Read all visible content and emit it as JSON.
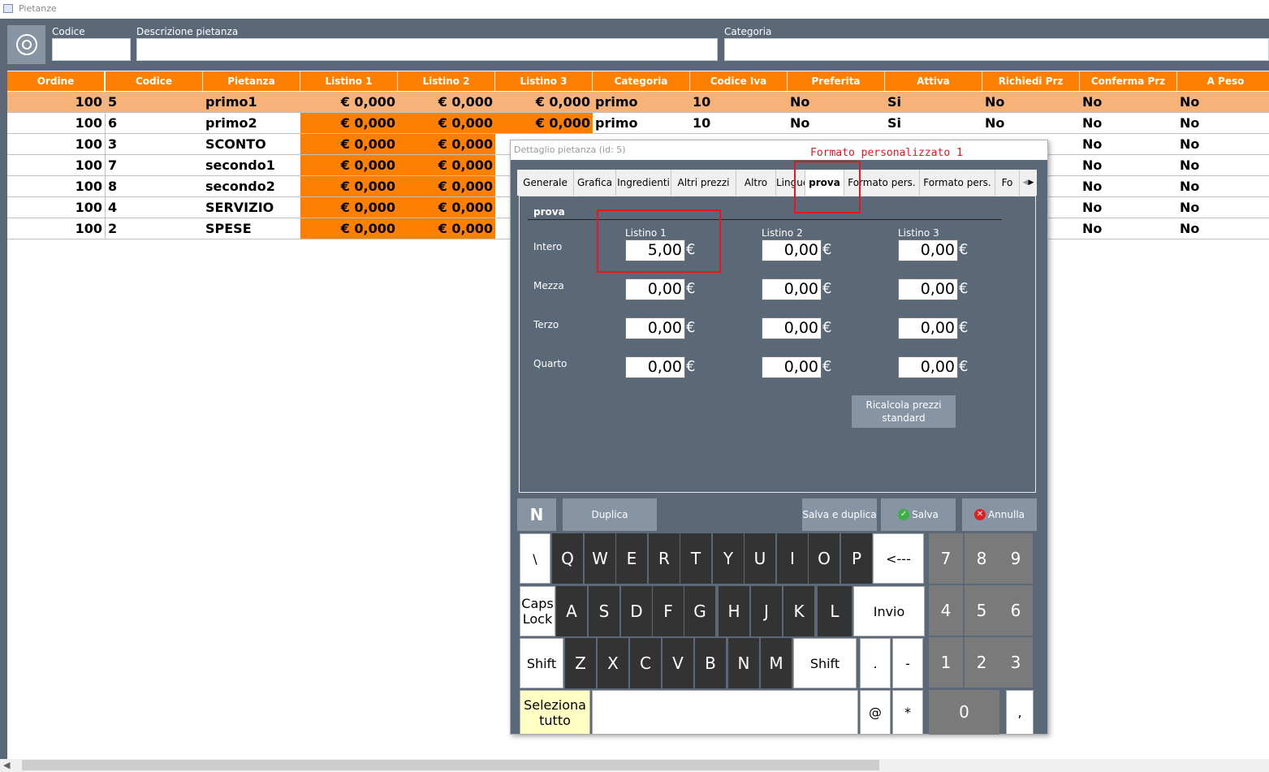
{
  "window": {
    "title": "Pietanze"
  },
  "filters": {
    "codice_label": "Codice",
    "descrizione_label": "Descrizione pietanza",
    "categoria_label": "Categoria",
    "codice_value": "",
    "descrizione_value": "",
    "categoria_value": ""
  },
  "table": {
    "columns": [
      "Ordine",
      "Codice",
      "Pietanza",
      "Listino 1",
      "Listino 2",
      "Listino 3",
      "Categoria",
      "Codice Iva",
      "Preferita",
      "Attiva",
      "Richiedi Prz",
      "Conferma Prz",
      "A Peso"
    ],
    "rows": [
      [
        "100",
        "5",
        "primo1",
        "€ 0,000",
        "€ 0,000",
        "€ 0,000",
        "primo",
        "10",
        "No",
        "Si",
        "No",
        "No",
        "No"
      ],
      [
        "100",
        "6",
        "primo2",
        "€ 0,000",
        "€ 0,000",
        "€ 0,000",
        "primo",
        "10",
        "No",
        "Si",
        "No",
        "No",
        "No"
      ],
      [
        "100",
        "3",
        "SCONTO",
        "€ 0,000",
        "€ 0,000",
        "",
        "",
        "",
        "",
        "",
        "",
        "No",
        "No"
      ],
      [
        "100",
        "7",
        "secondo1",
        "€ 0,000",
        "€ 0,000",
        "",
        "",
        "",
        "",
        "",
        "",
        "No",
        "No"
      ],
      [
        "100",
        "8",
        "secondo2",
        "€ 0,000",
        "€ 0,000",
        "",
        "",
        "",
        "",
        "",
        "",
        "No",
        "No"
      ],
      [
        "100",
        "4",
        "SERVIZIO",
        "€ 0,000",
        "€ 0,000",
        "",
        "",
        "",
        "",
        "",
        "",
        "No",
        "No"
      ],
      [
        "100",
        "2",
        "SPESE",
        "€ 0,000",
        "€ 0,000",
        "",
        "",
        "",
        "",
        "",
        "",
        "No",
        "No"
      ]
    ],
    "selected_row": 0
  },
  "annotation": {
    "text": "Formato personalizzato 1",
    "color": "#e8141e"
  },
  "dialog": {
    "title": "Dettaglio pietanza (id: 5)",
    "tabs": [
      "Generale",
      "Grafica",
      "Ingredienti",
      "Altri prezzi",
      "Altro",
      "Lingue",
      "prova",
      "Formato pers.",
      "Formato pers.",
      "Fo"
    ],
    "active_tab": "prova",
    "section_title": "prova",
    "price_headers": [
      "Listino 1",
      "Listino 2",
      "Listino 3"
    ],
    "currency": "€",
    "price_rows": [
      {
        "label": "Intero",
        "values": [
          "5,00",
          "0,00",
          "0,00"
        ]
      },
      {
        "label": "Mezza",
        "values": [
          "0,00",
          "0,00",
          "0,00"
        ]
      },
      {
        "label": "Terzo",
        "values": [
          "0,00",
          "0,00",
          "0,00"
        ]
      },
      {
        "label": "Quarto",
        "values": [
          "0,00",
          "0,00",
          "0,00"
        ]
      }
    ],
    "recalc_label": "Ricalcola prezzi standard",
    "n_label": "N",
    "duplica_label": "Duplica",
    "salva_duplica_label": "Salva e duplica",
    "salva_label": "Salva",
    "annulla_label": "Annulla"
  },
  "keyboard": {
    "row1": [
      "\\",
      "Q",
      "W",
      "E",
      "R",
      "T",
      "Y",
      "U",
      "I",
      "O",
      "P",
      "<---"
    ],
    "row2": [
      "Caps Lock",
      "A",
      "S",
      "D",
      "F",
      "G",
      "H",
      "J",
      "K",
      "L",
      "Invio"
    ],
    "row3": [
      "Shift",
      "Z",
      "X",
      "C",
      "V",
      "B",
      "N",
      "M",
      "Shift",
      ".",
      "-"
    ],
    "row4": [
      "Seleziona tutto",
      "",
      "@",
      "*"
    ],
    "numpad": [
      "7",
      "8",
      "9",
      "4",
      "5",
      "6",
      "1",
      "2",
      "3",
      "0",
      ","
    ]
  },
  "colors": {
    "header_orange": "#ff7f00",
    "panel": "#5a6878",
    "selected_row": "#f7b27a",
    "highlight": "#e8141e"
  }
}
